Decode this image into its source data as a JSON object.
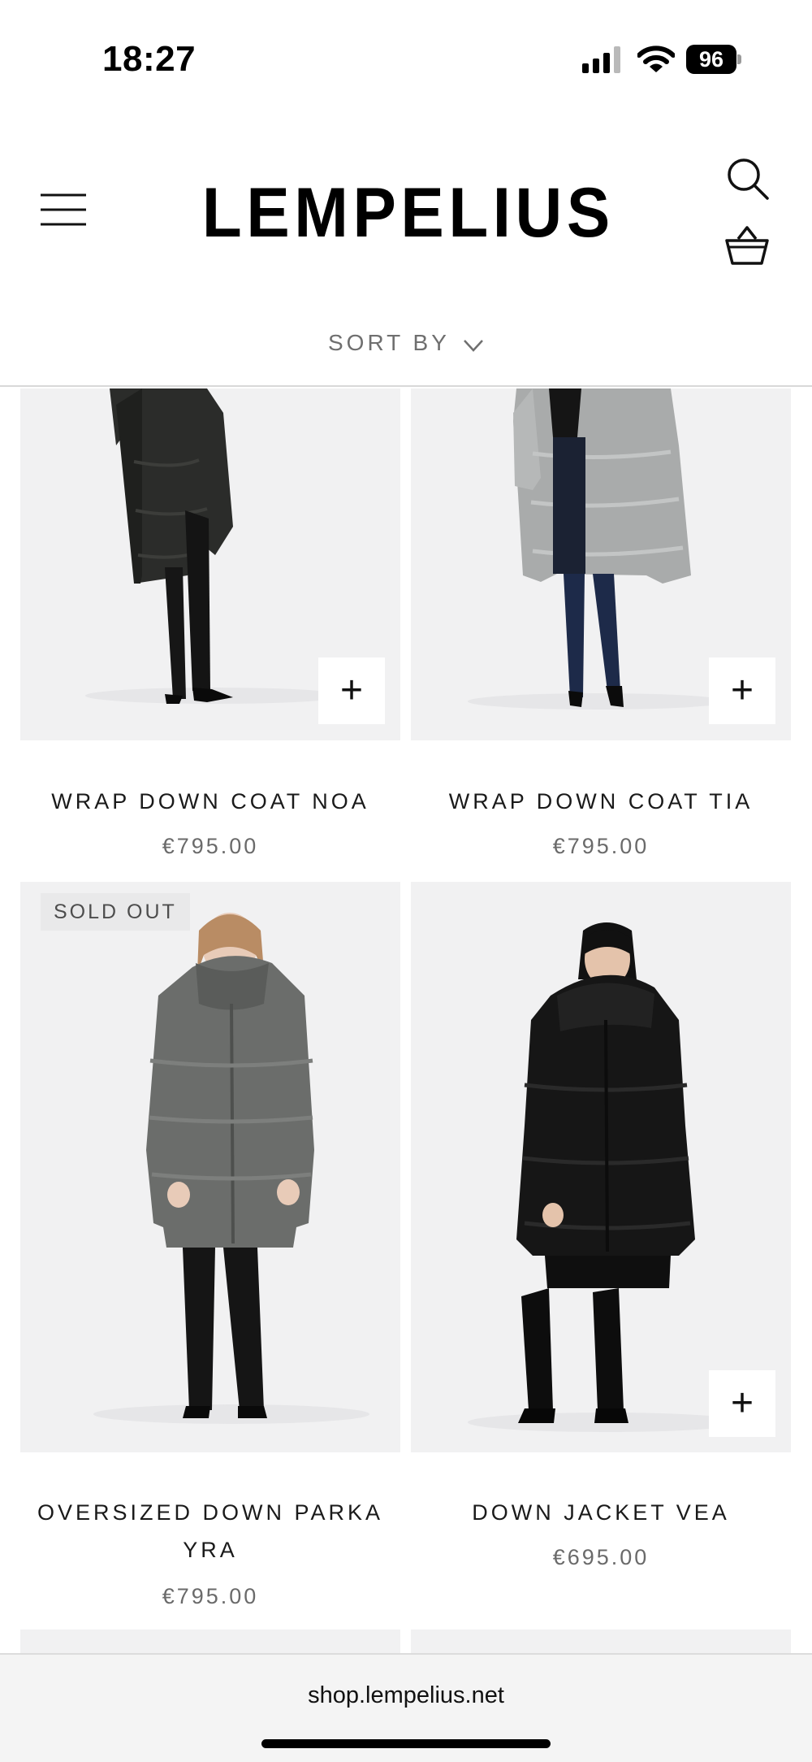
{
  "status": {
    "time": "18:27",
    "battery": "96"
  },
  "header": {
    "logo": "LEMPELIUS"
  },
  "sort": {
    "label": "SORT BY"
  },
  "products": [
    {
      "name": "WRAP DOWN COAT NOA",
      "price": "€795.00"
    },
    {
      "name": "WRAP DOWN COAT TIA",
      "price": "€795.00"
    },
    {
      "name": "OVERSIZED DOWN PARKA YRA",
      "price": "€795.00",
      "badge": "SOLD OUT"
    },
    {
      "name": "DOWN JACKET VEA",
      "price": "€695.00"
    }
  ],
  "browser": {
    "url": "shop.lempelius.net"
  }
}
